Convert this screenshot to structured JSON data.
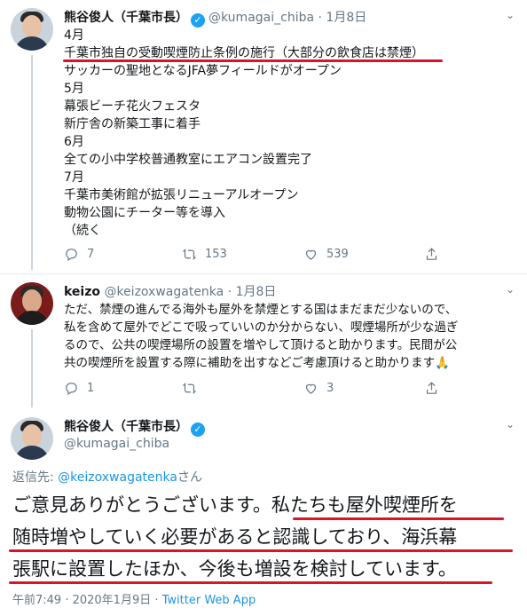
{
  "tweet1": {
    "name": "熊谷俊人（千葉市長）",
    "handle": "@kumagai_chiba",
    "date": "· 1月8日",
    "lines": [
      "4月",
      "千葉市独自の受動喫煙防止条例の施行（大部分の飲食店は禁煙）",
      "サッカーの聖地となるJFA夢フィールドがオープン",
      "5月",
      "幕張ビーチ花火フェスタ",
      "新庁舎の新築工事に着手",
      "6月",
      "全ての小中学校普通教室にエアコン設置完了",
      "7月",
      "千葉市美術館が拡張リニューアルオープン",
      "動物公園にチーター等を導入",
      "（続く"
    ],
    "replies": "7",
    "retweets": "153",
    "likes": "539"
  },
  "tweet2": {
    "name": "keizo",
    "handle": "@keizoxwagatenka",
    "date": "· 1月8日",
    "lines": [
      "ただ、禁煙の進んでる海外も屋外を禁煙とする国はまだまだ少ないので、",
      "私を含めて屋外でどこで吸っていいのか分からない、喫煙場所が少な過ぎ",
      "るので、公共の喫煙場所の設置を増やして頂けると助かります。民間が公",
      "共の喫煙所を設置する際に補助を出すなどご考慮頂けると助かります🙏"
    ],
    "replies": "1",
    "retweets": "",
    "likes": "3"
  },
  "tweet3": {
    "name": "熊谷俊人（千葉市長）",
    "handle": "@kumagai_chiba",
    "reply_prefix": "返信先: ",
    "reply_to": "@keizoxwagatenka",
    "reply_suffix": "さん",
    "lines": [
      "ご意見ありがとうございます。私たちも屋外喫煙所を",
      "随時増やしていく必要があると認識しており、海浜幕",
      "張駅に設置したほか、今後も増設を検討しています。"
    ],
    "timestamp": "午前7:49 · 2020年1月9日 · ",
    "source": "Twitter Web App"
  },
  "colors": {
    "accent": "#1da1f2",
    "underline": "#d9152a",
    "muted": "#657786"
  },
  "icons": [
    "verified-icon",
    "chevron-down-icon",
    "reply-icon",
    "retweet-icon",
    "like-icon",
    "share-icon"
  ]
}
